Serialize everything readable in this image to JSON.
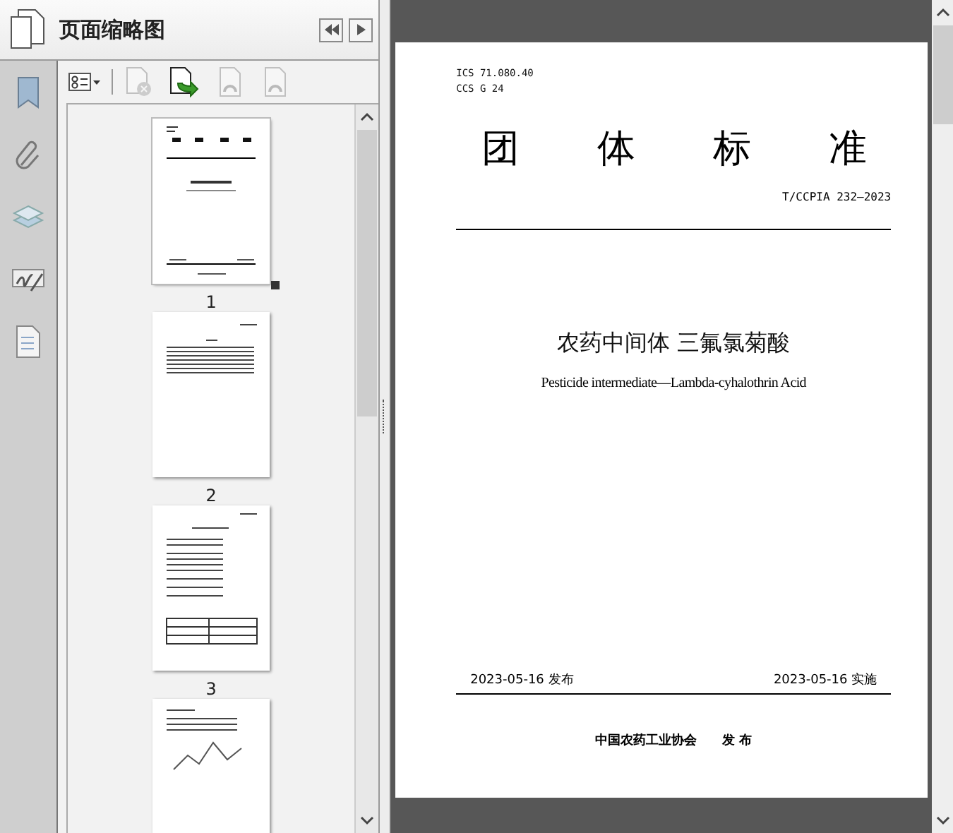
{
  "panel": {
    "title": "页面缩略图"
  },
  "toolbar": [
    {
      "kind": "options",
      "disabled": false
    },
    {
      "kind": "delete",
      "disabled": true
    },
    {
      "kind": "insert",
      "disabled": false
    },
    {
      "kind": "undo",
      "disabled": true
    },
    {
      "kind": "redo",
      "disabled": true
    }
  ],
  "rail": [
    {
      "kind": "bookmarks"
    },
    {
      "kind": "attachments"
    },
    {
      "kind": "layers"
    },
    {
      "kind": "signatures"
    },
    {
      "kind": "pages"
    }
  ],
  "thumbnails": [
    {
      "kind": "cover",
      "label": "1",
      "selected": true
    },
    {
      "kind": "text",
      "label": "2",
      "selected": false
    },
    {
      "kind": "table",
      "label": "3",
      "selected": false
    },
    {
      "kind": "chart",
      "selected": false
    }
  ],
  "document": {
    "ics": "ICS  71.080.40",
    "ccs": "CCS  G 24",
    "heading": "团体标准",
    "number": "T/CCPIA 232—2023",
    "title": "农药中间体  三氟氯菊酸",
    "subtitle": "Pesticide intermediate—Lambda-cyhalothrin Acid",
    "issued": "2023-05-16 发布",
    "effective": "2023-05-16 实施",
    "publisher": "中国农药工业协会",
    "publish_label": "发 布"
  }
}
